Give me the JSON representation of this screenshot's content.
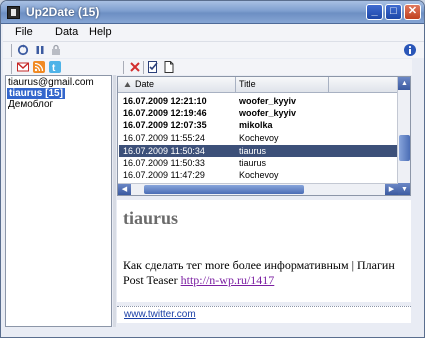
{
  "window": {
    "title": "Up2Date (15)",
    "controls": {
      "minimize": "_",
      "maximize": "□",
      "close": "✕"
    }
  },
  "menu": [
    {
      "label": "File"
    },
    {
      "label": "Data"
    },
    {
      "label": "Help"
    }
  ],
  "toolbar": {
    "icons": [
      "refresh-icon",
      "pause-icon",
      "lock-icon"
    ],
    "info_icon": "info-icon"
  },
  "accounts_toolbar": {
    "icons": [
      "gmail-icon",
      "rss-icon",
      "twitter-icon"
    ]
  },
  "accounts": [
    {
      "label": "tiaurus@gmail.com",
      "selected": false
    },
    {
      "label": "tiaurus [15]",
      "selected": true
    },
    {
      "label": "Демоблог",
      "selected": false
    }
  ],
  "list_toolbar": {
    "icons": [
      "delete-icon",
      "mark-read-icon",
      "document-icon"
    ]
  },
  "list": {
    "columns": [
      {
        "label": "Date",
        "sorted": "ascending"
      },
      {
        "label": "Title"
      }
    ],
    "rows": [
      {
        "date": "16.07.2009 12:21:10",
        "title": "woofer_kyyiv",
        "bold": true,
        "selected": false
      },
      {
        "date": "16.07.2009 12:19:46",
        "title": "woofer_kyyiv",
        "bold": true,
        "selected": false
      },
      {
        "date": "16.07.2009 12:07:35",
        "title": "mikolka",
        "bold": true,
        "selected": false
      },
      {
        "date": "16.07.2009 11:55:24",
        "title": "Kochevoy",
        "bold": false,
        "selected": false
      },
      {
        "date": "16.07.2009 11:50:34",
        "title": "tiaurus",
        "bold": false,
        "selected": true
      },
      {
        "date": "16.07.2009 11:50:33",
        "title": "tiaurus",
        "bold": false,
        "selected": false
      },
      {
        "date": "16.07.2009 11:47:29",
        "title": "Kochevoy",
        "bold": false,
        "selected": false
      }
    ]
  },
  "article": {
    "author": "tiaurus",
    "text": "Как сделать тег more более информативным | Плагин Post Teaser ",
    "link": "http://n-wp.ru/1417"
  },
  "footer": {
    "link": "www.twitter.com"
  },
  "colors": {
    "titlebar": "#7f9fcf",
    "selection_account": "#3366cc",
    "selection_row": "#3c5079",
    "link": "#7b1fa2",
    "footer_link": "#1a3fa6"
  }
}
